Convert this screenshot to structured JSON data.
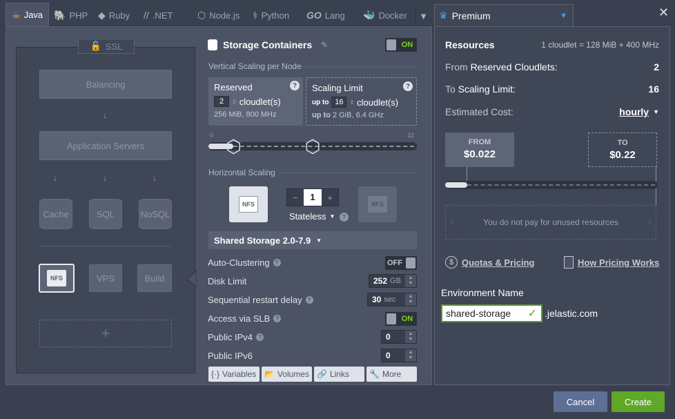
{
  "tabs": [
    {
      "label": "Java",
      "icon": "java-icon",
      "active": true
    },
    {
      "label": "PHP",
      "icon": "php-icon"
    },
    {
      "label": "Ruby",
      "icon": "ruby-icon"
    },
    {
      "label": ".NET",
      "icon": "dotnet-icon"
    },
    {
      "label": "Node.js",
      "icon": "nodejs-icon"
    },
    {
      "label": "Python",
      "icon": "python-icon"
    },
    {
      "label": "Lang",
      "icon": "go-icon",
      "prefix": "GO"
    },
    {
      "label": "Docker",
      "icon": "docker-icon"
    }
  ],
  "topology": {
    "ssl": "SSL",
    "balancing": "Balancing",
    "app_servers": "Application Servers",
    "cache": "Cache",
    "sql": "SQL",
    "nosql": "NoSQL",
    "nfs": "NFS",
    "vps": "VPS",
    "build": "Build",
    "add": "+"
  },
  "config": {
    "title": "Storage Containers",
    "title_toggle": "ON",
    "vertical_label": "Vertical Scaling per Node",
    "reserved": {
      "title": "Reserved",
      "value": "2",
      "unit": "cloudlet(s)",
      "spec": "256 MiB, 800 MHz"
    },
    "limit": {
      "title": "Scaling Limit",
      "prefix": "up to",
      "value": "16",
      "unit": "cloudlet(s)",
      "spec_prefix": "up to",
      "spec": "2 GiB, 6.4 GHz"
    },
    "slider_min": "0",
    "slider_max": "32",
    "slider_reserved": 2,
    "slider_limit": 16,
    "horizontal_label": "Horizontal Scaling",
    "node_icon": "NFS",
    "node_count": "1",
    "minus": "−",
    "plus": "+",
    "mode": "Stateless",
    "storage_select": "Shared Storage 2.0-7.9",
    "rows": {
      "auto_clustering": {
        "label": "Auto-Clustering",
        "value": "OFF"
      },
      "disk_limit": {
        "label": "Disk Limit",
        "value": "252",
        "unit": "GB"
      },
      "restart_delay": {
        "label": "Sequential restart delay",
        "value": "30",
        "unit": "sec"
      },
      "slb": {
        "label": "Access via SLB",
        "value": "ON"
      },
      "ipv4": {
        "label": "Public IPv4",
        "value": "0"
      },
      "ipv6": {
        "label": "Public IPv6",
        "value": "0"
      }
    },
    "buttons": {
      "variables": "Variables",
      "volumes": "Volumes",
      "links": "Links",
      "more": "More"
    }
  },
  "premium": {
    "tab_label": "Premium",
    "resources_title": "Resources",
    "cloudlet_def": "1 cloudlet = 128 MiB + 400 MHz",
    "from_prefix": "From",
    "from_label": "Reserved Cloudlets:",
    "from_value": "2",
    "to_prefix": "To",
    "to_label": "Scaling Limit:",
    "to_value": "16",
    "cost_label": "Estimated Cost:",
    "cost_period": "hourly",
    "price_from_label": "FROM",
    "price_from": "$0.022",
    "price_to_label": "TO",
    "price_to": "$0.22",
    "notice": "You do not pay for unused resources",
    "quotas_link": "Quotas & Pricing",
    "how_link": "How Pricing Works",
    "env_label": "Environment Name",
    "env_value": "shared-storage",
    "env_domain": ".jelastic.com"
  },
  "footer": {
    "cancel": "Cancel",
    "create": "Create"
  },
  "colors": {
    "accent_green": "#5fa828",
    "cancel_blue": "#5e6f96",
    "toggle_on": "#7ed321",
    "java_orange": "#ff9e45"
  }
}
